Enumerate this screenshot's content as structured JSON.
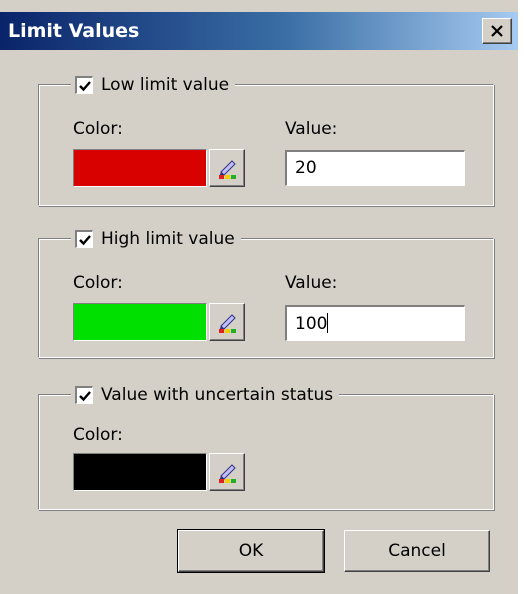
{
  "window": {
    "title": "Limit Values"
  },
  "groups": {
    "low": {
      "label": "Low limit value",
      "checked": true,
      "color_label": "Color:",
      "color": "#d90000",
      "value_label": "Value:",
      "value": "20"
    },
    "high": {
      "label": "High limit value",
      "checked": true,
      "color_label": "Color:",
      "color": "#00e000",
      "value_label": "Value:",
      "value": "100"
    },
    "uncertain": {
      "label": "Value with uncertain status",
      "checked": true,
      "color_label": "Color:",
      "color": "#000000"
    }
  },
  "buttons": {
    "ok": "OK",
    "cancel": "Cancel"
  },
  "icons": {
    "close": "close-icon",
    "color_picker": "pen-palette-icon",
    "check": "checkmark-icon"
  }
}
